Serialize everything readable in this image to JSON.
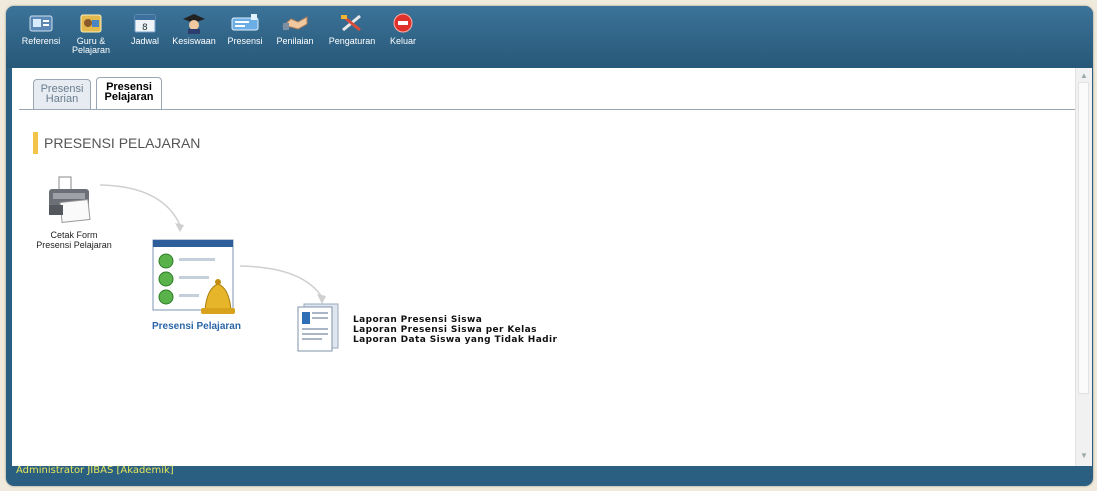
{
  "toolbar": {
    "items": [
      {
        "label": "Referensi",
        "icon": "reference-icon"
      },
      {
        "label": "Guru &\nPelajaran",
        "icon": "teacher-lesson-icon"
      },
      {
        "label": "Jadwal",
        "icon": "calendar-icon"
      },
      {
        "label": "Kesiswaan",
        "icon": "student-icon"
      },
      {
        "label": "Presensi",
        "icon": "attendance-icon"
      },
      {
        "label": "Penilaian",
        "icon": "handshake-icon"
      },
      {
        "label": "Pengaturan",
        "icon": "tools-icon"
      },
      {
        "label": "Keluar",
        "icon": "power-icon"
      }
    ]
  },
  "tabs": [
    {
      "label": "Presensi\nHarian",
      "active": false
    },
    {
      "label": "Presensi\nPelajaran",
      "active": true
    }
  ],
  "section_title": "PRESENSI PELAJARAN",
  "flow": {
    "print_label": "Cetak Form\nPresensi Pelajaran",
    "main_label": "Presensi Pelajaran",
    "reports": [
      "Laporan Presensi Siswa",
      "Laporan Presensi Siswa per Kelas",
      "Laporan Data Siswa yang Tidak Hadir"
    ]
  },
  "status": "Administrator JIBAS [Akademik]",
  "colors": {
    "frame": "#2b5f82",
    "accent": "#f4c34a",
    "link": "#2a66a8",
    "status": "#e5e85a"
  }
}
